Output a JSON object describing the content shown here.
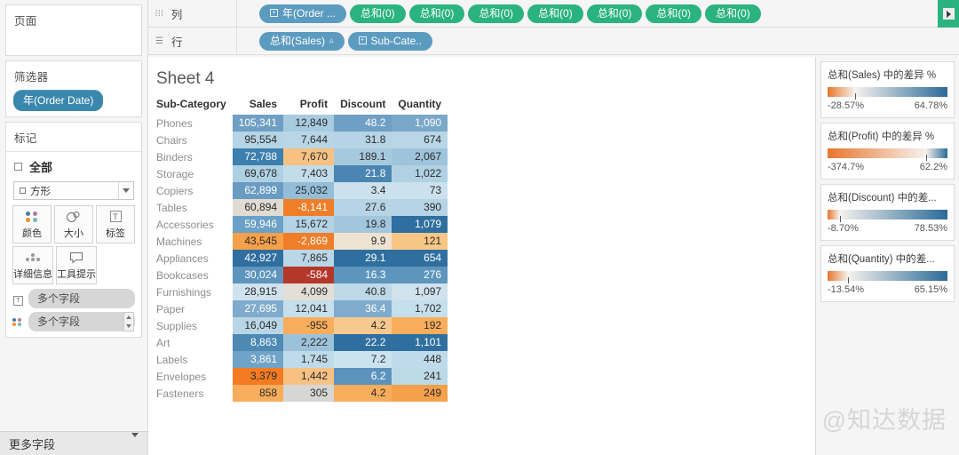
{
  "sidebar": {
    "pages": {
      "title": "页面"
    },
    "filters": {
      "title": "筛选器",
      "pills": [
        {
          "label": "年(Order Date)"
        }
      ]
    },
    "marks": {
      "title": "标记",
      "all_label": "全部",
      "mark_type": "方形",
      "buttons": [
        {
          "label": "颜色",
          "icon": "color-dots-icon"
        },
        {
          "label": "大小",
          "icon": "size-icon"
        },
        {
          "label": "标签",
          "icon": "label-icon"
        },
        {
          "label": "详细信息",
          "icon": "detail-icon"
        },
        {
          "label": "工具提示",
          "icon": "tooltip-icon"
        }
      ],
      "field_pills": [
        {
          "label": "多个字段",
          "icon": "label-icon"
        },
        {
          "label": "多个字段",
          "icon": "color-dots-icon"
        }
      ]
    },
    "more_fields": {
      "label": "更多字段"
    }
  },
  "shelves": {
    "columns": {
      "label": "列",
      "icon": "columns-icon",
      "pills": [
        {
          "label": "年(Order ...",
          "type": "blue",
          "expand": true
        },
        {
          "label": "总和(0)",
          "type": "green"
        },
        {
          "label": "总和(0)",
          "type": "green"
        },
        {
          "label": "总和(0)",
          "type": "green"
        },
        {
          "label": "总和(0)",
          "type": "green"
        },
        {
          "label": "总和(0)",
          "type": "green"
        },
        {
          "label": "总和(0)",
          "type": "green"
        },
        {
          "label": "总和(0)",
          "type": "green"
        }
      ]
    },
    "rows": {
      "label": "行",
      "icon": "rows-icon",
      "pills": [
        {
          "label": "总和(Sales)",
          "type": "blue",
          "sort": "▵"
        },
        {
          "label": "Sub-Cate..",
          "type": "blue",
          "expand": true
        }
      ]
    }
  },
  "view": {
    "title": "Sheet 4",
    "columns": [
      "Sub-Category",
      "Sales",
      "Profit",
      "Discount",
      "Quantity"
    ],
    "rows": [
      {
        "name": "Phones",
        "sales": "105,341",
        "profit": "12,849",
        "discount": "48.2",
        "quantity": "1,090",
        "sales_bg": "#6f9fc4",
        "sales_fg": "#ffffff",
        "profit_bg": "#a8cbe0",
        "profit_fg": "#2b2b2b",
        "discount_bg": "#6f9fc4",
        "discount_fg": "#ffffff",
        "quantity_bg": "#7aa8c9",
        "quantity_fg": "#ffffff"
      },
      {
        "name": "Chairs",
        "sales": "95,554",
        "profit": "7,644",
        "discount": "31.8",
        "quantity": "674",
        "sales_bg": "#b5d4e5",
        "sales_fg": "#2b2b2b",
        "profit_bg": "#b9d6e6",
        "profit_fg": "#2b2b2b",
        "discount_bg": "#b5d4e5",
        "discount_fg": "#2b2b2b",
        "quantity_bg": "#b9d6e6",
        "quantity_fg": "#2b2b2b"
      },
      {
        "name": "Binders",
        "sales": "72,788",
        "profit": "7,670",
        "discount": "189.1",
        "quantity": "2,067",
        "sales_bg": "#3d7fae",
        "sales_fg": "#ffffff",
        "profit_bg": "#f6c183",
        "profit_fg": "#2b2b2b",
        "discount_bg": "#a6c9de",
        "discount_fg": "#2b2b2b",
        "quantity_bg": "#9dc4db",
        "quantity_fg": "#2b2b2b"
      },
      {
        "name": "Storage",
        "sales": "69,678",
        "profit": "7,403",
        "discount": "21.8",
        "quantity": "1,022",
        "sales_bg": "#aed0e3",
        "sales_fg": "#2b2b2b",
        "profit_bg": "#c3dcea",
        "profit_fg": "#2b2b2b",
        "discount_bg": "#4b86b2",
        "discount_fg": "#ffffff",
        "quantity_bg": "#b0d1e4",
        "quantity_fg": "#2b2b2b"
      },
      {
        "name": "Copiers",
        "sales": "62,899",
        "profit": "25,032",
        "discount": "3.4",
        "quantity": "73",
        "sales_bg": "#6a9cc2",
        "sales_fg": "#ffffff",
        "profit_bg": "#94bed8",
        "profit_fg": "#2b2b2b",
        "discount_bg": "#cbe1ed",
        "discount_fg": "#2b2b2b",
        "quantity_bg": "#cbe1ed",
        "quantity_fg": "#2b2b2b"
      },
      {
        "name": "Tables",
        "sales": "60,894",
        "profit": "-8,141",
        "discount": "27.6",
        "quantity": "390",
        "sales_bg": "#e0dcd4",
        "sales_fg": "#2b2b2b",
        "profit_bg": "#f07d28",
        "profit_fg": "#ffffff",
        "discount_bg": "#b6d4e6",
        "discount_fg": "#2b2b2b",
        "quantity_bg": "#b6d4e6",
        "quantity_fg": "#2b2b2b"
      },
      {
        "name": "Accessories",
        "sales": "59,946",
        "profit": "15,672",
        "discount": "19.8",
        "quantity": "1,079",
        "sales_bg": "#6ba0c7",
        "sales_fg": "#ffffff",
        "profit_bg": "#b4d3e5",
        "profit_fg": "#2b2b2b",
        "discount_bg": "#a2c7dd",
        "discount_fg": "#2b2b2b",
        "quantity_bg": "#2f6f9f",
        "quantity_fg": "#ffffff"
      },
      {
        "name": "Machines",
        "sales": "43,545",
        "profit": "-2,869",
        "discount": "9.9",
        "quantity": "121",
        "sales_bg": "#f5a04a",
        "sales_fg": "#2b2b2b",
        "profit_bg": "#f07d28",
        "profit_fg": "#ffffff",
        "discount_bg": "#eee2d0",
        "discount_fg": "#2b2b2b",
        "quantity_bg": "#f8c684",
        "quantity_fg": "#2b2b2b"
      },
      {
        "name": "Appliances",
        "sales": "42,927",
        "profit": "7,865",
        "discount": "29.1",
        "quantity": "654",
        "sales_bg": "#2f6f9f",
        "sales_fg": "#ffffff",
        "profit_bg": "#bad7e7",
        "profit_fg": "#2b2b2b",
        "discount_bg": "#2f6f9f",
        "discount_fg": "#ffffff",
        "quantity_bg": "#2f6f9f",
        "quantity_fg": "#ffffff"
      },
      {
        "name": "Bookcases",
        "sales": "30,024",
        "profit": "-584",
        "discount": "16.3",
        "quantity": "276",
        "sales_bg": "#5e95bd",
        "sales_fg": "#ffffff",
        "profit_bg": "#b5372a",
        "profit_fg": "#ffffff",
        "discount_bg": "#5e95bd",
        "discount_fg": "#ffffff",
        "quantity_bg": "#5e95bd",
        "quantity_fg": "#ffffff"
      },
      {
        "name": "Furnishings",
        "sales": "28,915",
        "profit": "4,099",
        "discount": "40.8",
        "quantity": "1,097",
        "sales_bg": "#cfe2ed",
        "sales_fg": "#2b2b2b",
        "profit_bg": "#e3ded6",
        "profit_fg": "#2b2b2b",
        "discount_bg": "#bdd9e8",
        "discount_fg": "#2b2b2b",
        "quantity_bg": "#cfe2ed",
        "quantity_fg": "#2b2b2b"
      },
      {
        "name": "Paper",
        "sales": "27,695",
        "profit": "12,041",
        "discount": "36.4",
        "quantity": "1,702",
        "sales_bg": "#7fabcc",
        "sales_fg": "#ffffff",
        "profit_bg": "#c6dfec",
        "profit_fg": "#2b2b2b",
        "discount_bg": "#7fabcc",
        "discount_fg": "#ffffff",
        "quantity_bg": "#c6dfec",
        "quantity_fg": "#2b2b2b"
      },
      {
        "name": "Supplies",
        "sales": "16,049",
        "profit": "-955",
        "discount": "4.2",
        "quantity": "192",
        "sales_bg": "#b9d6e6",
        "sales_fg": "#2b2b2b",
        "profit_bg": "#f8ad5c",
        "profit_fg": "#2b2b2b",
        "discount_bg": "#f7c98f",
        "discount_fg": "#2b2b2b",
        "quantity_bg": "#f8ad5c",
        "quantity_fg": "#2b2b2b"
      },
      {
        "name": "Art",
        "sales": "8,863",
        "profit": "2,222",
        "discount": "22.2",
        "quantity": "1,101",
        "sales_bg": "#4e89b4",
        "sales_fg": "#ffffff",
        "profit_bg": "#9cc2da",
        "profit_fg": "#2b2b2b",
        "discount_bg": "#2f6f9f",
        "discount_fg": "#ffffff",
        "quantity_bg": "#2f6f9f",
        "quantity_fg": "#ffffff"
      },
      {
        "name": "Labels",
        "sales": "3,861",
        "profit": "1,745",
        "discount": "7.2",
        "quantity": "448",
        "sales_bg": "#6fa3c8",
        "sales_fg": "#ffffff",
        "profit_bg": "#bfdaea",
        "profit_fg": "#2b2b2b",
        "discount_bg": "#cbe3ef",
        "discount_fg": "#2b2b2b",
        "quantity_bg": "#bfdaea",
        "quantity_fg": "#2b2b2b"
      },
      {
        "name": "Envelopes",
        "sales": "3,379",
        "profit": "1,442",
        "discount": "6.2",
        "quantity": "241",
        "sales_bg": "#f47b22",
        "sales_fg": "#2b2b2b",
        "profit_bg": "#f8c184",
        "profit_fg": "#2b2b2b",
        "discount_bg": "#5b93bc",
        "discount_fg": "#ffffff",
        "quantity_bg": "#bcd9e8",
        "quantity_fg": "#2b2b2b"
      },
      {
        "name": "Fasteners",
        "sales": "858",
        "profit": "305",
        "discount": "4.2",
        "quantity": "249",
        "sales_bg": "#f8ad5c",
        "sales_fg": "#2b2b2b",
        "profit_bg": "#d6d6d4",
        "profit_fg": "#2b2b2b",
        "discount_bg": "#f8ad5c",
        "discount_fg": "#2b2b2b",
        "quantity_bg": "#f5a04a",
        "quantity_fg": "#2b2b2b"
      }
    ]
  },
  "legends": [
    {
      "title": "总和(Sales) 中的差异 %",
      "min": "-28.57%",
      "max": "64.78%",
      "tick_pct": 23
    },
    {
      "title": "总和(Profit) 中的差异 %",
      "min": "-374.7%",
      "max": "62.2%",
      "tick_pct": 82
    },
    {
      "title": "总和(Discount) 中的差...",
      "min": "-8.70%",
      "max": "78.53%",
      "tick_pct": 10
    },
    {
      "title": "总和(Quantity) 中的差...",
      "min": "-13.54%",
      "max": "65.15%",
      "tick_pct": 17
    }
  ],
  "watermark": {
    "text": "@知达数据"
  },
  "colors": {
    "pill_blue": "#5b9bc0",
    "pill_green": "#2bb37f",
    "filter_pill": "#3a87ad",
    "gradient_low": "#e8762c",
    "gradient_mid": "#f5f2ee",
    "gradient_high": "#2a6a97"
  },
  "chart_data": {
    "type": "heatmap",
    "title": "Sheet 4",
    "xlabel": "",
    "ylabel": "Sub-Category",
    "categories": [
      "Phones",
      "Chairs",
      "Binders",
      "Storage",
      "Copiers",
      "Tables",
      "Accessories",
      "Machines",
      "Appliances",
      "Bookcases",
      "Furnishings",
      "Paper",
      "Supplies",
      "Art",
      "Labels",
      "Envelopes",
      "Fasteners"
    ],
    "measures": [
      "Sales",
      "Profit",
      "Discount",
      "Quantity"
    ],
    "series": [
      {
        "name": "Sales",
        "values": [
          105341,
          95554,
          72788,
          69678,
          62899,
          60894,
          59946,
          43545,
          42927,
          30024,
          28915,
          27695,
          16049,
          8863,
          3861,
          3379,
          858
        ]
      },
      {
        "name": "Profit",
        "values": [
          12849,
          7644,
          7670,
          7403,
          25032,
          -8141,
          15672,
          -2869,
          7865,
          -584,
          4099,
          12041,
          -955,
          2222,
          1745,
          1442,
          305
        ]
      },
      {
        "name": "Discount",
        "values": [
          48.2,
          31.8,
          189.1,
          21.8,
          3.4,
          27.6,
          19.8,
          9.9,
          29.1,
          16.3,
          40.8,
          36.4,
          4.2,
          22.2,
          7.2,
          6.2,
          4.2
        ]
      },
      {
        "name": "Quantity",
        "values": [
          1090,
          674,
          2067,
          1022,
          73,
          390,
          1079,
          121,
          654,
          276,
          1097,
          1702,
          192,
          1101,
          448,
          241,
          249
        ]
      }
    ],
    "color_encoding": "difference percent vs prior year, diverging orange-blue",
    "legend_position": "right",
    "grid": false
  }
}
